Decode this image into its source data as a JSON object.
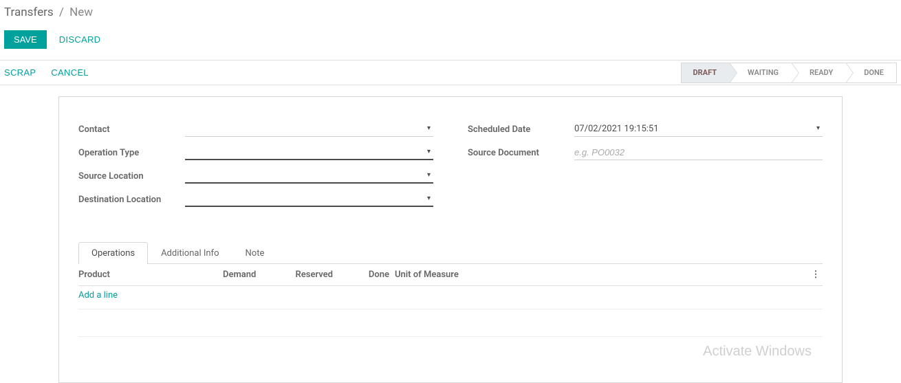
{
  "breadcrumb": {
    "root": "Transfers",
    "sep": "/",
    "current": "New"
  },
  "buttons": {
    "save": "SAVE",
    "discard": "DISCARD",
    "scrap": "SCRAP",
    "cancel": "CANCEL"
  },
  "status": {
    "draft": "DRAFT",
    "waiting": "WAITING",
    "ready": "READY",
    "done": "DONE"
  },
  "form": {
    "contact_label": "Contact",
    "operation_type_label": "Operation Type",
    "source_location_label": "Source Location",
    "destination_location_label": "Destination Location",
    "scheduled_date_label": "Scheduled Date",
    "scheduled_date_value": "07/02/2021 19:15:51",
    "source_document_label": "Source Document",
    "source_document_placeholder": "e.g. PO0032"
  },
  "tabs": {
    "operations": "Operations",
    "additional_info": "Additional Info",
    "note": "Note"
  },
  "table": {
    "headers": {
      "product": "Product",
      "demand": "Demand",
      "reserved": "Reserved",
      "done": "Done",
      "uom": "Unit of Measure"
    },
    "add_line": "Add a line"
  },
  "icons": {
    "caret": "▾",
    "kebab": "⋮"
  },
  "watermark": "Activate Windows"
}
